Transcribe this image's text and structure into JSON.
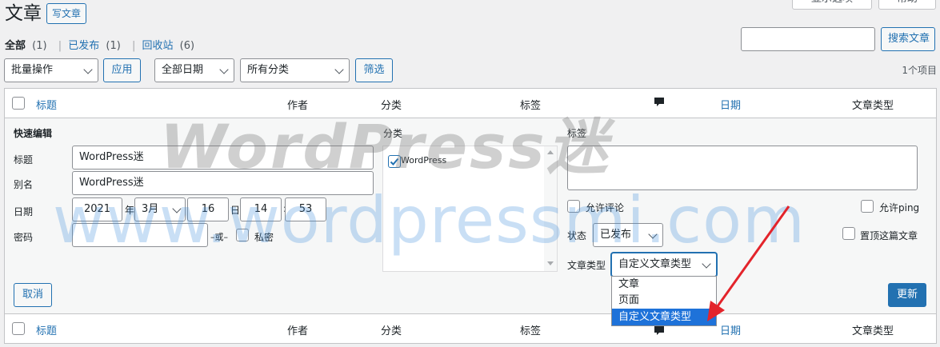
{
  "header": {
    "title": "文章",
    "add_new_label": "写文章",
    "top_button_1": "显示选项",
    "top_button_2": "帮助"
  },
  "filters": {
    "all_label": "全部",
    "all_count": "(1)",
    "published_label": "已发布",
    "published_count": "(1)",
    "trash_label": "回收站",
    "trash_count": "(6)",
    "separator": "|"
  },
  "search": {
    "value": "",
    "button_label": "搜索文章"
  },
  "toolbar": {
    "bulk_action": "批量操作",
    "apply_label": "应用",
    "date_filter": "全部日期",
    "category_filter": "所有分类",
    "filter_label": "筛选",
    "item_count": "1个项目"
  },
  "table": {
    "columns": {
      "title": "标题",
      "author": "作者",
      "category": "分类",
      "tags": "标签",
      "comments_icon": "comment-icon",
      "date": "日期",
      "post_type": "文章类型"
    }
  },
  "quick_edit": {
    "heading": "快速编辑",
    "title_label": "标题",
    "title_value": "WordPress迷",
    "slug_label": "别名",
    "slug_value": "WordPress迷",
    "date_label": "日期",
    "year": "2021",
    "year_unit": "年",
    "month": "3月",
    "day": "16",
    "day_unit": "日",
    "hour": "14",
    "time_sep": ":",
    "minute": "53",
    "password_label": "密码",
    "password_value": "",
    "or_label": "–或–",
    "private_label": "私密",
    "categories_label": "分类",
    "category_item": "WordPress",
    "tags_label": "标签",
    "tags_value": "",
    "allow_comments": "允许评论",
    "allow_ping": "允许ping",
    "status_label": "状态",
    "status_value": "已发布",
    "sticky_label": "置顶这篇文章",
    "post_type_label": "文章类型",
    "post_type_value": "自定义文章类型",
    "post_type_options": [
      "文章",
      "页面",
      "自定义文章类型"
    ],
    "cancel_label": "取消",
    "update_label": "更新"
  },
  "watermark": {
    "text_1": "WordPress迷",
    "text_2": "www.wordpressmi.com"
  },
  "colors": {
    "accent": "#2271b1",
    "arrow": "#e3242b"
  }
}
